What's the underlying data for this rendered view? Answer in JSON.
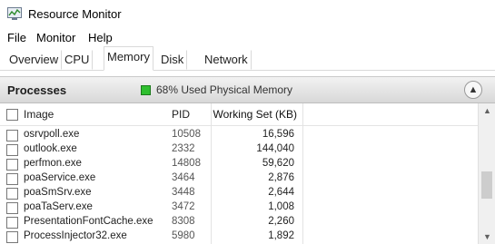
{
  "window": {
    "title": "Resource Monitor",
    "icon": "resource-monitor-icon"
  },
  "menu": {
    "items": [
      "File",
      "Monitor",
      "Help"
    ]
  },
  "tabs": {
    "items": [
      "Overview",
      "CPU",
      "Memory",
      "Disk",
      "Network"
    ],
    "active": "Memory"
  },
  "processes": {
    "title": "Processes",
    "status_text": "68% Used Physical Memory",
    "status_color": "#2fbf2f",
    "columns": {
      "image": "Image",
      "pid": "PID",
      "working_set": "Working Set (KB)"
    },
    "rows": [
      {
        "image": "osrvpoll.exe",
        "pid": "10508",
        "ws": "16,596"
      },
      {
        "image": "outlook.exe",
        "pid": "2332",
        "ws": "144,040"
      },
      {
        "image": "perfmon.exe",
        "pid": "14808",
        "ws": "59,620"
      },
      {
        "image": "poaService.exe",
        "pid": "3464",
        "ws": "2,876"
      },
      {
        "image": "poaSmSrv.exe",
        "pid": "3448",
        "ws": "2,644"
      },
      {
        "image": "poaTaServ.exe",
        "pid": "3472",
        "ws": "1,008"
      },
      {
        "image": "PresentationFontCache.exe",
        "pid": "8308",
        "ws": "2,260"
      },
      {
        "image": "ProcessInjector32.exe",
        "pid": "5980",
        "ws": "1,892"
      }
    ]
  }
}
